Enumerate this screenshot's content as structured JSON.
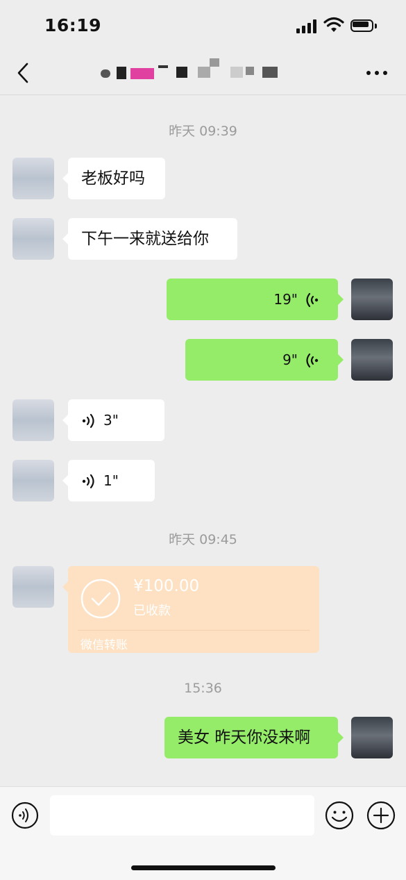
{
  "status_bar": {
    "time": "16:19"
  },
  "nav": {
    "title": ""
  },
  "messages": [
    {
      "type": "time",
      "text": "昨天 09:39"
    },
    {
      "type": "text",
      "side": "in",
      "text": "老板好吗"
    },
    {
      "type": "text",
      "side": "in",
      "text": "下午一来就送给你"
    },
    {
      "type": "voice",
      "side": "out",
      "duration": "19\""
    },
    {
      "type": "voice",
      "side": "out",
      "duration": "9\""
    },
    {
      "type": "voice",
      "side": "in",
      "duration": "3\""
    },
    {
      "type": "voice",
      "side": "in",
      "duration": "1\""
    },
    {
      "type": "time",
      "text": "昨天 09:45"
    },
    {
      "type": "transfer",
      "side": "in",
      "amount": "¥100.00",
      "status": "已收款",
      "footer": "微信转账"
    },
    {
      "type": "time",
      "text": "15:36"
    },
    {
      "type": "text",
      "side": "out",
      "text": "美女 昨天你没来啊"
    }
  ],
  "input": {
    "placeholder": ""
  },
  "colors": {
    "outgoing_bubble": "#95ec69",
    "incoming_bubble": "#ffffff",
    "transfer_card": "#fde1c2",
    "background": "#ededed"
  }
}
